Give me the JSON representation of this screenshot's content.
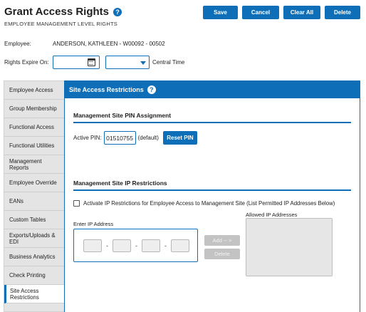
{
  "header": {
    "title": "Grant Access Rights",
    "help_icon": "?",
    "subtitle": "EMPLOYEE MANAGEMENT LEVEL RIGHTS"
  },
  "toolbar": {
    "save_label": "Save",
    "cancel_label": "Cancel",
    "clear_all_label": "Clear All",
    "delete_label": "Delete"
  },
  "employee": {
    "label": "Employee:",
    "value": "ANDERSON, KATHLEEN - W00092 - 00502"
  },
  "expiry": {
    "label": "Rights Expire On:",
    "date_value": "",
    "time_value": "",
    "timezone": "Central Time"
  },
  "sidebar": {
    "items": [
      {
        "label": "Employee Access"
      },
      {
        "label": "Group Membership"
      },
      {
        "label": "Functional Access"
      },
      {
        "label": "Functional Utilities"
      },
      {
        "label": "Management Reports"
      },
      {
        "label": "Employee Override"
      },
      {
        "label": "EANs"
      },
      {
        "label": "Custom Tables"
      },
      {
        "label": "Exports/Uploads & EDI"
      },
      {
        "label": "Business Analytics"
      },
      {
        "label": "Check Printing"
      },
      {
        "label": "Site Access Restrictions"
      }
    ],
    "active_index": 11
  },
  "panel": {
    "title": "Site Access Restrictions",
    "help_icon": "?",
    "pin_section": {
      "title": "Management Site PIN Assignment",
      "active_pin_label": "Active PIN:",
      "active_pin_value": "01510755",
      "default_note": "(default)",
      "reset_label": "Reset PIN"
    },
    "ip_section": {
      "title": "Management Site IP Restrictions",
      "checkbox_label": "Activate IP Restrictions for Employee Access to Management Site (List Permitted IP Addresses Below)",
      "checkbox_checked": false,
      "enter_ip_label": "Enter IP Address",
      "separator": "-",
      "allowed_label": "Allowed IP Addresses",
      "add_label": "Add -- >",
      "delete_label": "Delete"
    }
  },
  "colors": {
    "accent": "#0e6fb8",
    "sidebar_bg": "#e4e4e4",
    "disabled_btn": "#c3c3c3"
  }
}
